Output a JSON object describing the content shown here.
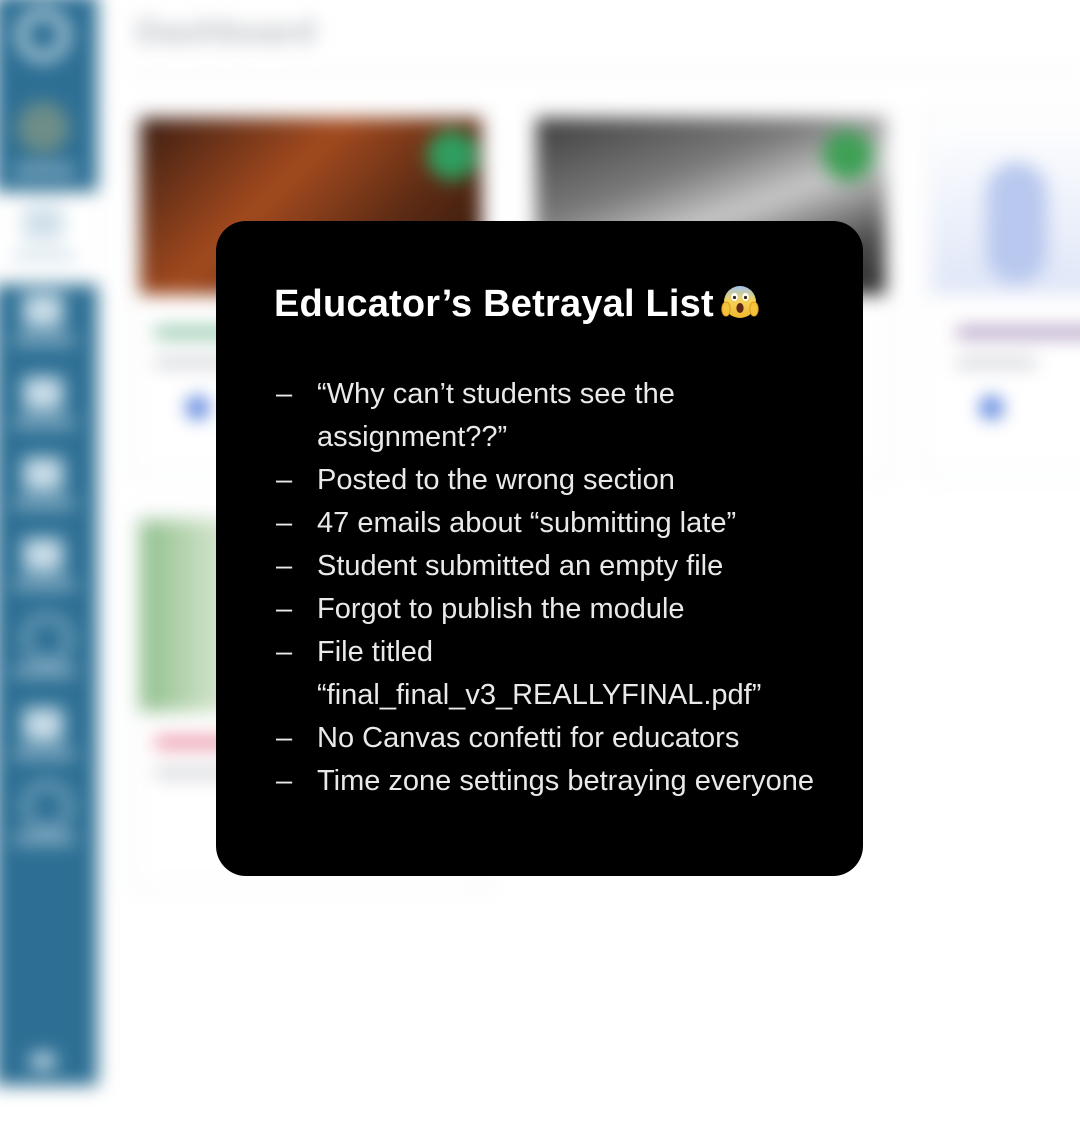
{
  "background": {
    "page_title": "Dashboard"
  },
  "popup": {
    "title": "Educator’s Betrayal List",
    "title_emoji": "face-screaming-in-fear-icon",
    "bullet_char": "–",
    "items": [
      "“Why can’t students see the assignment??”",
      "Posted to the wrong section",
      "47 emails about “submitting late”",
      "Student submitted an empty file",
      "Forgot to publish the module",
      "File titled “final_final_v3_REALLYFINAL.pdf”",
      "No Canvas confetti for educators",
      "Time zone settings betraying everyone"
    ]
  },
  "colors": {
    "sidebar": "#2d6f94",
    "popup_bg": "#000000",
    "popup_text": "#e9e9e9"
  }
}
